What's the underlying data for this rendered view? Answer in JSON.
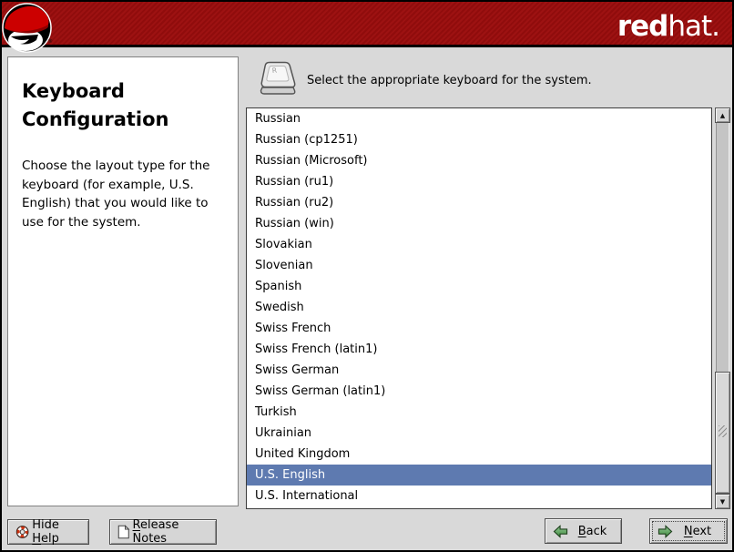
{
  "header": {
    "brand_bold": "red",
    "brand_light": "hat."
  },
  "help_panel": {
    "title": "Keyboard Configuration",
    "body": "Choose the layout type for the keyboard (for example, U.S. English) that you would like to use for the system."
  },
  "main": {
    "prompt": "Select the appropriate keyboard for the system.",
    "prompt_icon": "keyboard-key-icon",
    "key_letter": "R"
  },
  "keyboard_list": {
    "items": [
      "Russian",
      "Russian (cp1251)",
      "Russian (Microsoft)",
      "Russian (ru1)",
      "Russian (ru2)",
      "Russian (win)",
      "Slovakian",
      "Slovenian",
      "Spanish",
      "Swedish",
      "Swiss French",
      "Swiss French (latin1)",
      "Swiss German",
      "Swiss German (latin1)",
      "Turkish",
      "Ukrainian",
      "United Kingdom",
      "U.S. English",
      "U.S. International"
    ],
    "selected": "U.S. English"
  },
  "scrollbar": {
    "up_arrow": "▲",
    "down_arrow": "▼"
  },
  "footer": {
    "hide_help": {
      "label": "Hide Help",
      "mnemonic_index": 5,
      "icon": "lifebuoy-icon"
    },
    "release_notes": {
      "label": "Release Notes",
      "mnemonic_index": 0,
      "icon": "document-icon"
    },
    "back": {
      "label": "Back",
      "mnemonic_index": 0,
      "icon": "arrow-left-icon"
    },
    "next": {
      "label": "Next",
      "mnemonic_index": 0,
      "icon": "arrow-right-icon"
    }
  },
  "colors": {
    "header_red": "#9b0d0d",
    "selection_blue": "#5e7ab0",
    "selection_text": "#ffffff",
    "background_gray": "#d9d9d9",
    "arrow_green": "#4f9e4f"
  }
}
